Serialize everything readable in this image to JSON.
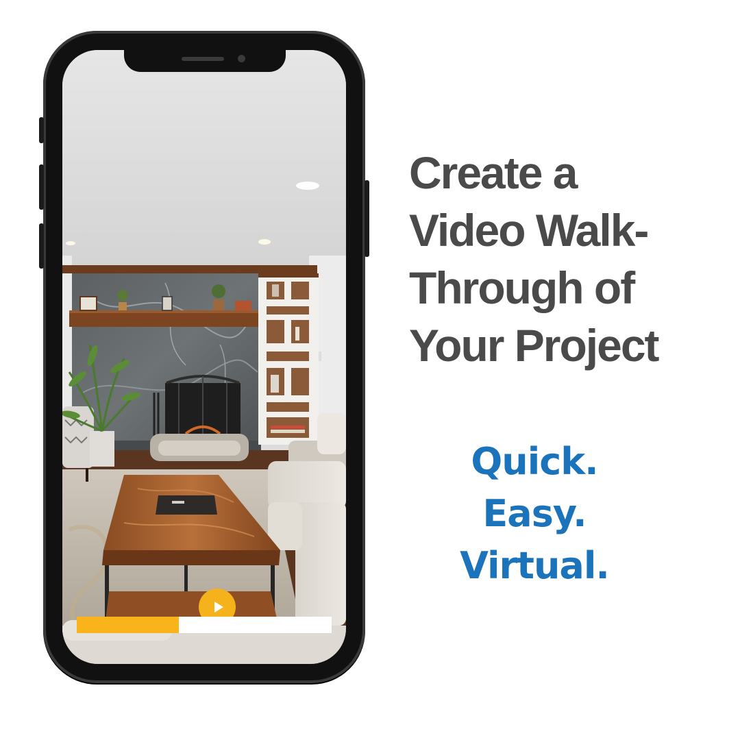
{
  "headline": {
    "lines": [
      "Create a",
      "Video Walk-",
      "Through of",
      "Your Project"
    ]
  },
  "tagline": {
    "lines": [
      "Quick.",
      "Easy.",
      "Virtual."
    ]
  },
  "video": {
    "progress_fraction": 0.4,
    "play_icon": "play-icon"
  },
  "colors": {
    "headline": "#4a4a4a",
    "tagline": "#1b74bb",
    "accent": "#f9b41c",
    "phone_frame": "#111111"
  }
}
